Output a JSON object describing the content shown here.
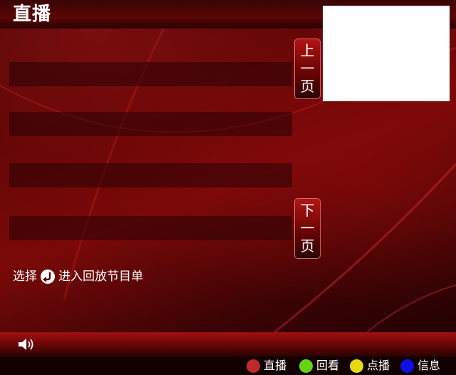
{
  "header": {
    "title": "直播"
  },
  "pager": {
    "prev_label": "上一页",
    "next_label": "下一页"
  },
  "hint": {
    "prefix": "选择",
    "suffix": "进入回放节目单"
  },
  "legend": [
    {
      "label": "直播",
      "color": "#c02a2a"
    },
    {
      "label": "回看",
      "color": "#66d414"
    },
    {
      "label": "点播",
      "color": "#e6dc10"
    },
    {
      "label": "信息",
      "color": "#1010e6"
    }
  ],
  "icons": {
    "return": "return-arrow-icon",
    "volume": "speaker-icon"
  }
}
